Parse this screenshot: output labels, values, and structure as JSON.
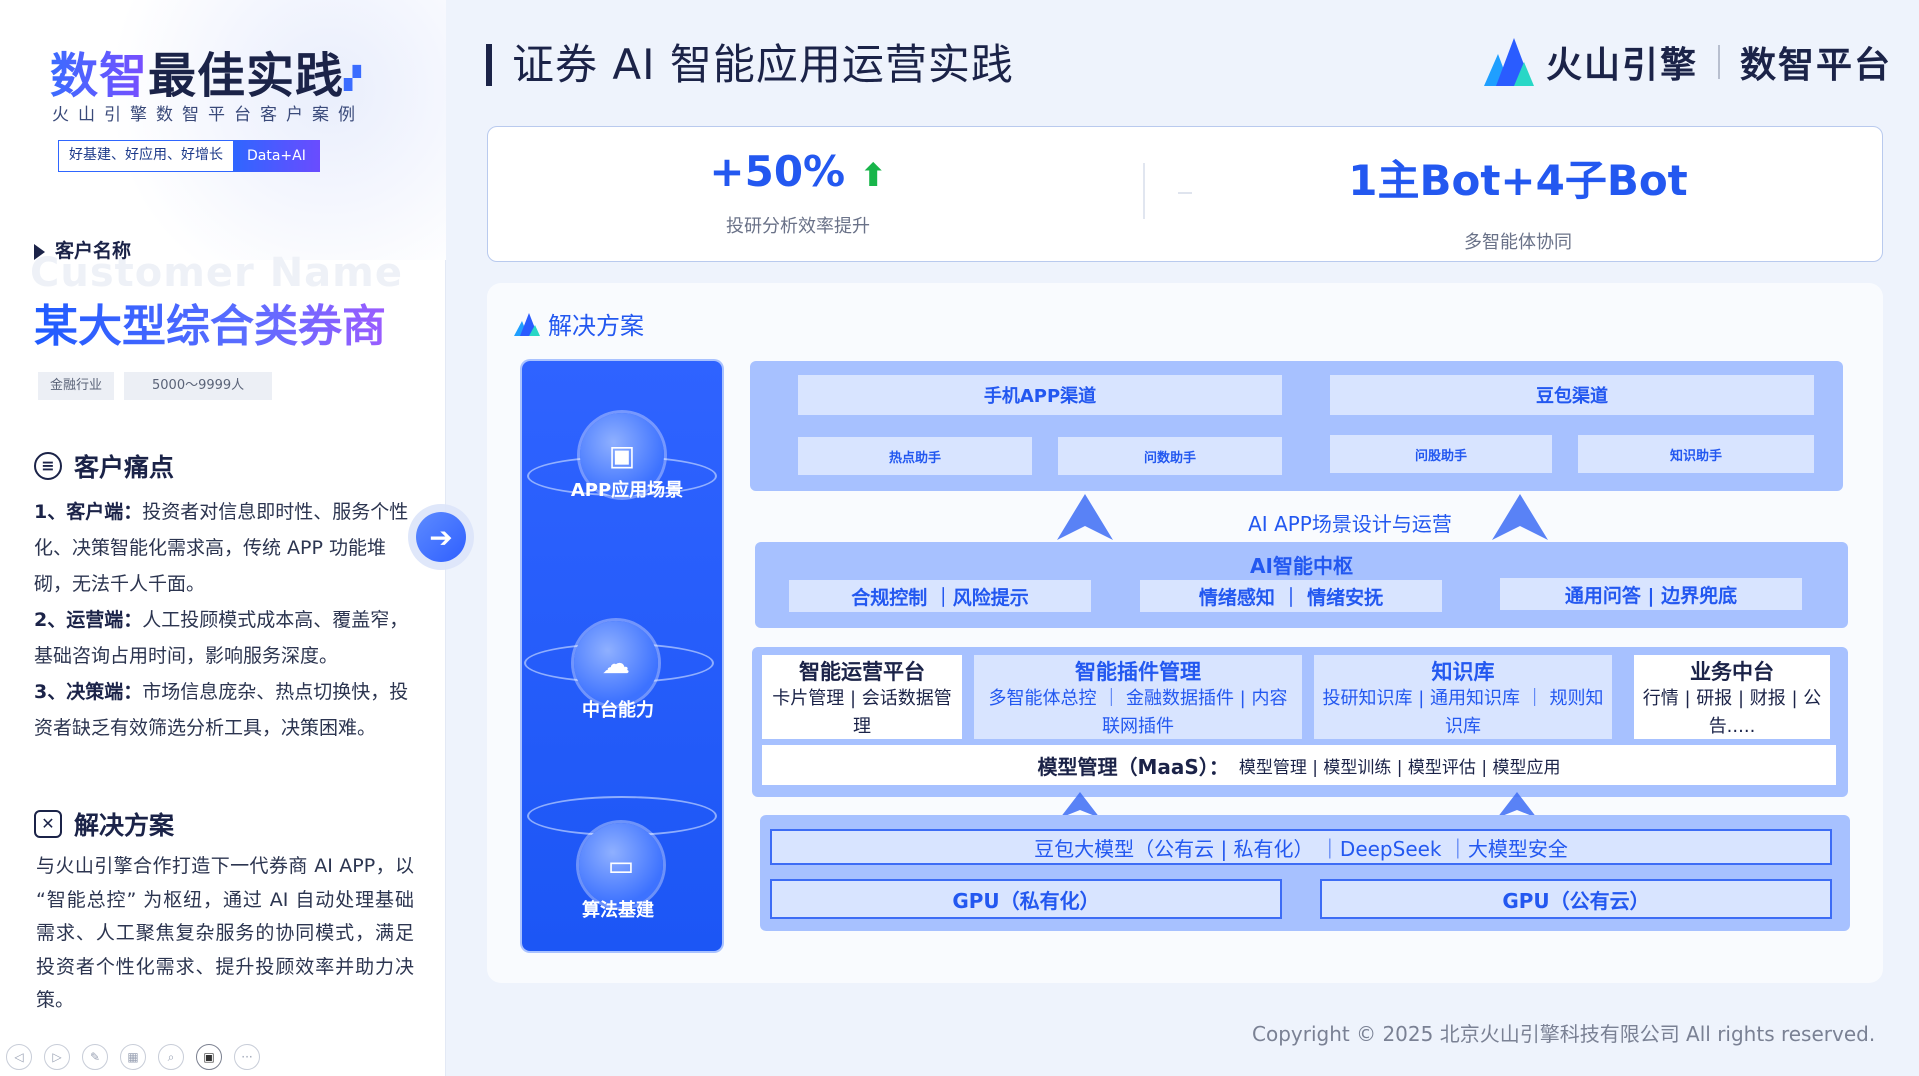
{
  "left": {
    "title_hl": "数智",
    "title_rest": "最佳实践",
    "subtitle": "火山引擎数智平台客户案例",
    "tag_a": "好基建、好应用、好增长",
    "tag_b": "Data+AI",
    "customer_label": "客户名称",
    "customer_ghost": "Customer Name",
    "customer_name": "某大型综合类券商",
    "chips": [
      "金融行业",
      "5000～9999人"
    ],
    "pain_title": "客户痛点",
    "pain": [
      {
        "k": "1、客户端：",
        "v": "投资者对信息即时性、服务个性化、决策智能化需求高，传统 APP 功能堆砌，无法千人千面。"
      },
      {
        "k": "2、运营端：",
        "v": "人工投顾模式成本高、覆盖窄，基础咨询占用时间，影响服务深度。"
      },
      {
        "k": "3、决策端：",
        "v": "市场信息庞杂、热点切换快，投资者缺乏有效筛选分析工具，决策困难。"
      }
    ],
    "solution_title": "解决方案",
    "solution_text": "与火山引擎合作打造下一代券商 AI APP，以 “智能总控” 为枢纽，通过 AI 自动处理基础需求、人工聚焦复杂服务的协同模式，满足投资者个性化需求、提升投顾效率并助力决策。"
  },
  "header": {
    "title": "证券 AI 智能应用运营实践",
    "logo_name": "火山引擎",
    "logo_product": "数智平台"
  },
  "stats": [
    {
      "value": "+50%",
      "label": "投研分析效率提升"
    },
    {
      "value": "1主Bot+4子Bot",
      "label": "多智能体协同"
    }
  ],
  "solution": {
    "title": "解决方案",
    "column": [
      "APP应用场景",
      "中台能力",
      "算法基建"
    ],
    "channels": [
      "手机APP渠道",
      "豆包渠道"
    ],
    "assistants": [
      "热点助手",
      "问数助手",
      "问股助手",
      "知识助手"
    ],
    "scene_label": "AI APP场景设计与运营",
    "hub": {
      "title": "AI智能中枢",
      "items": [
        "合规控制 ｜风险提示",
        "情绪感知 ｜ 情绪安抚",
        "通用问答 | 边界兜底"
      ]
    },
    "platform": [
      {
        "h": "智能运营平台",
        "d": "卡片管理 | 会话数据管理"
      },
      {
        "h": "智能插件管理",
        "d": "多智能体总控 ｜ 金融数据插件 | 内容联网插件"
      },
      {
        "h": "知识库",
        "d": "投研知识库 | 通用知识库 ｜ 规则知识库"
      },
      {
        "h": "业务中台",
        "d": "行情 | 研报 | 财报 | 公告....."
      }
    ],
    "maas_label": "模型管理（MaaS）：",
    "maas_items": "模型管理 | 模型训练 | 模型评估 | 模型应用",
    "model_row": "豆包大模型（公有云 | 私有化） ｜DeepSeek ｜大模型安全",
    "gpu": [
      "GPU（私有化）",
      "GPU（公有云）"
    ]
  },
  "copyright": "Copyright © 2025 北京火山引擎科技有限公司 All rights reserved.",
  "colors": {
    "accent": "#2358f0",
    "panel": "#a7c1ff",
    "cell": "#d8e4ff",
    "up": "#18b54a"
  }
}
